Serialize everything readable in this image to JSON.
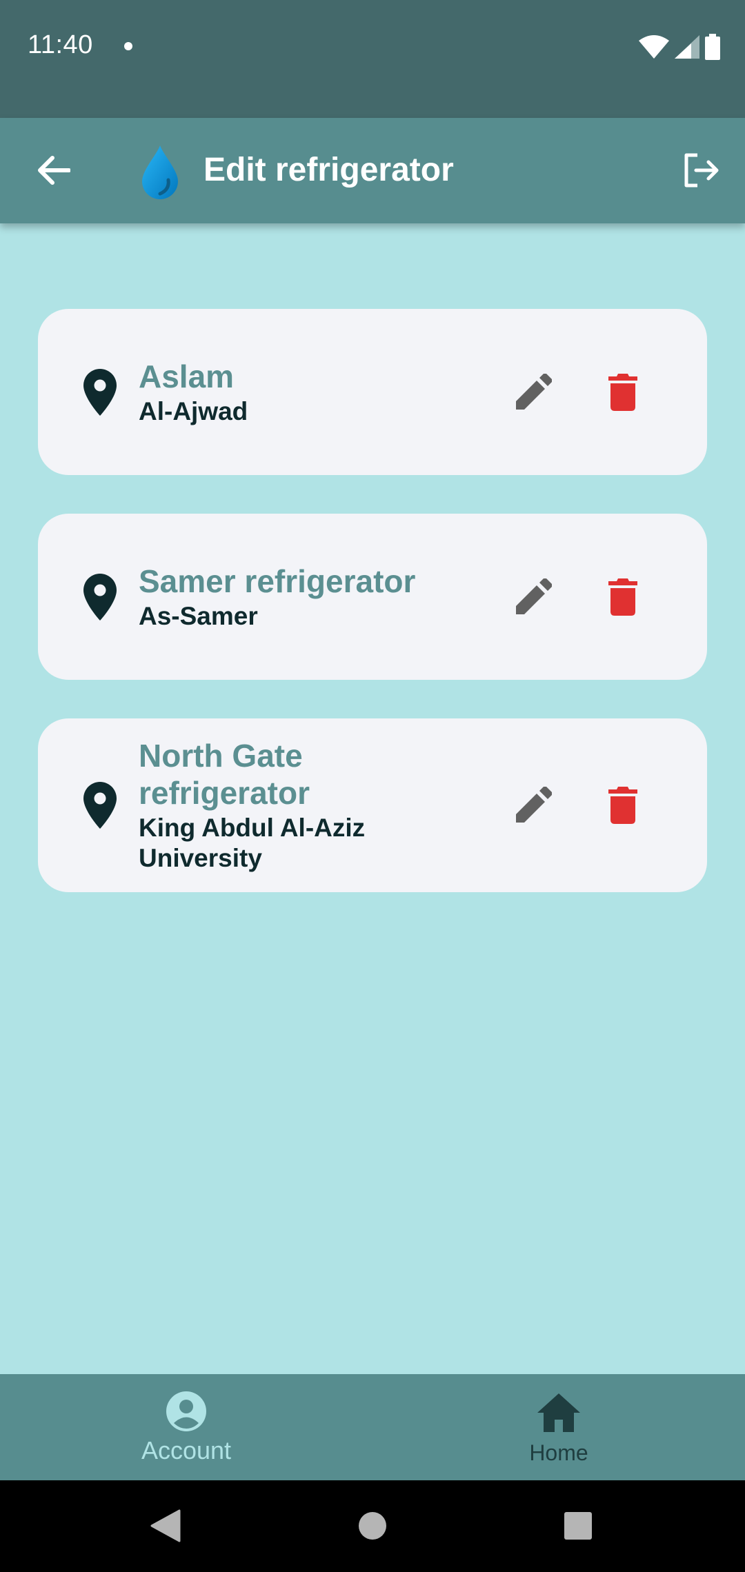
{
  "status_bar": {
    "time": "11:40",
    "icons": [
      "notification-dot-icon",
      "wifi-icon",
      "signal-icon",
      "battery-icon"
    ]
  },
  "app_bar": {
    "title": "Edit refrigerator",
    "icons": [
      "back-arrow-icon",
      "water-drop-logo-icon",
      "logout-icon"
    ]
  },
  "refrigerators": [
    {
      "name": "Aslam",
      "location": "Al-Ajwad"
    },
    {
      "name": "Samer refrigerator",
      "location": "As-Samer"
    },
    {
      "name": "North Gate refrigerator",
      "location": "King Abdul Al-Aziz University"
    }
  ],
  "bottom_nav": {
    "items": [
      {
        "label": "Account",
        "icon": "account-circle-icon",
        "selected": true
      },
      {
        "label": "Home",
        "icon": "home-icon",
        "selected": false
      }
    ]
  },
  "colors": {
    "status_bar": "#44696b",
    "app_bar": "#578d8f",
    "background": "#b0e3e5",
    "card": "#f3f4f8",
    "name_text": "#5b8f91",
    "location_text": "#0f2a2e",
    "delete_red": "#e03131",
    "edit_gray": "#616161"
  }
}
